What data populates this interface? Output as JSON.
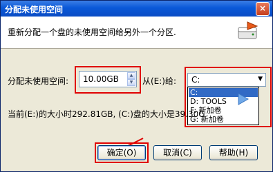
{
  "window": {
    "title": "分配未使用空间",
    "close": "×"
  },
  "header": {
    "description": "重新分配一个盘的未使用空间给另外一个分区.",
    "icon": "disk-partition-icon"
  },
  "form": {
    "amount_label": "分配未使用空间:",
    "amount_value": "10.00GB",
    "from_label": "从(E:)给:",
    "target_selected": "C:",
    "target_options": [
      "C:",
      "D: TOOLS",
      "F: 新加卷",
      "G: 新加卷"
    ],
    "info_text": "当前(E:)的大小时292.81GB, (C:)盘的大小是39.30G"
  },
  "buttons": {
    "ok": "确定(O)",
    "cancel": "取消(C)",
    "help": "帮助(H)"
  },
  "annotations": {
    "highlight_color": "#e00000",
    "selection_color": "#316ac5"
  }
}
